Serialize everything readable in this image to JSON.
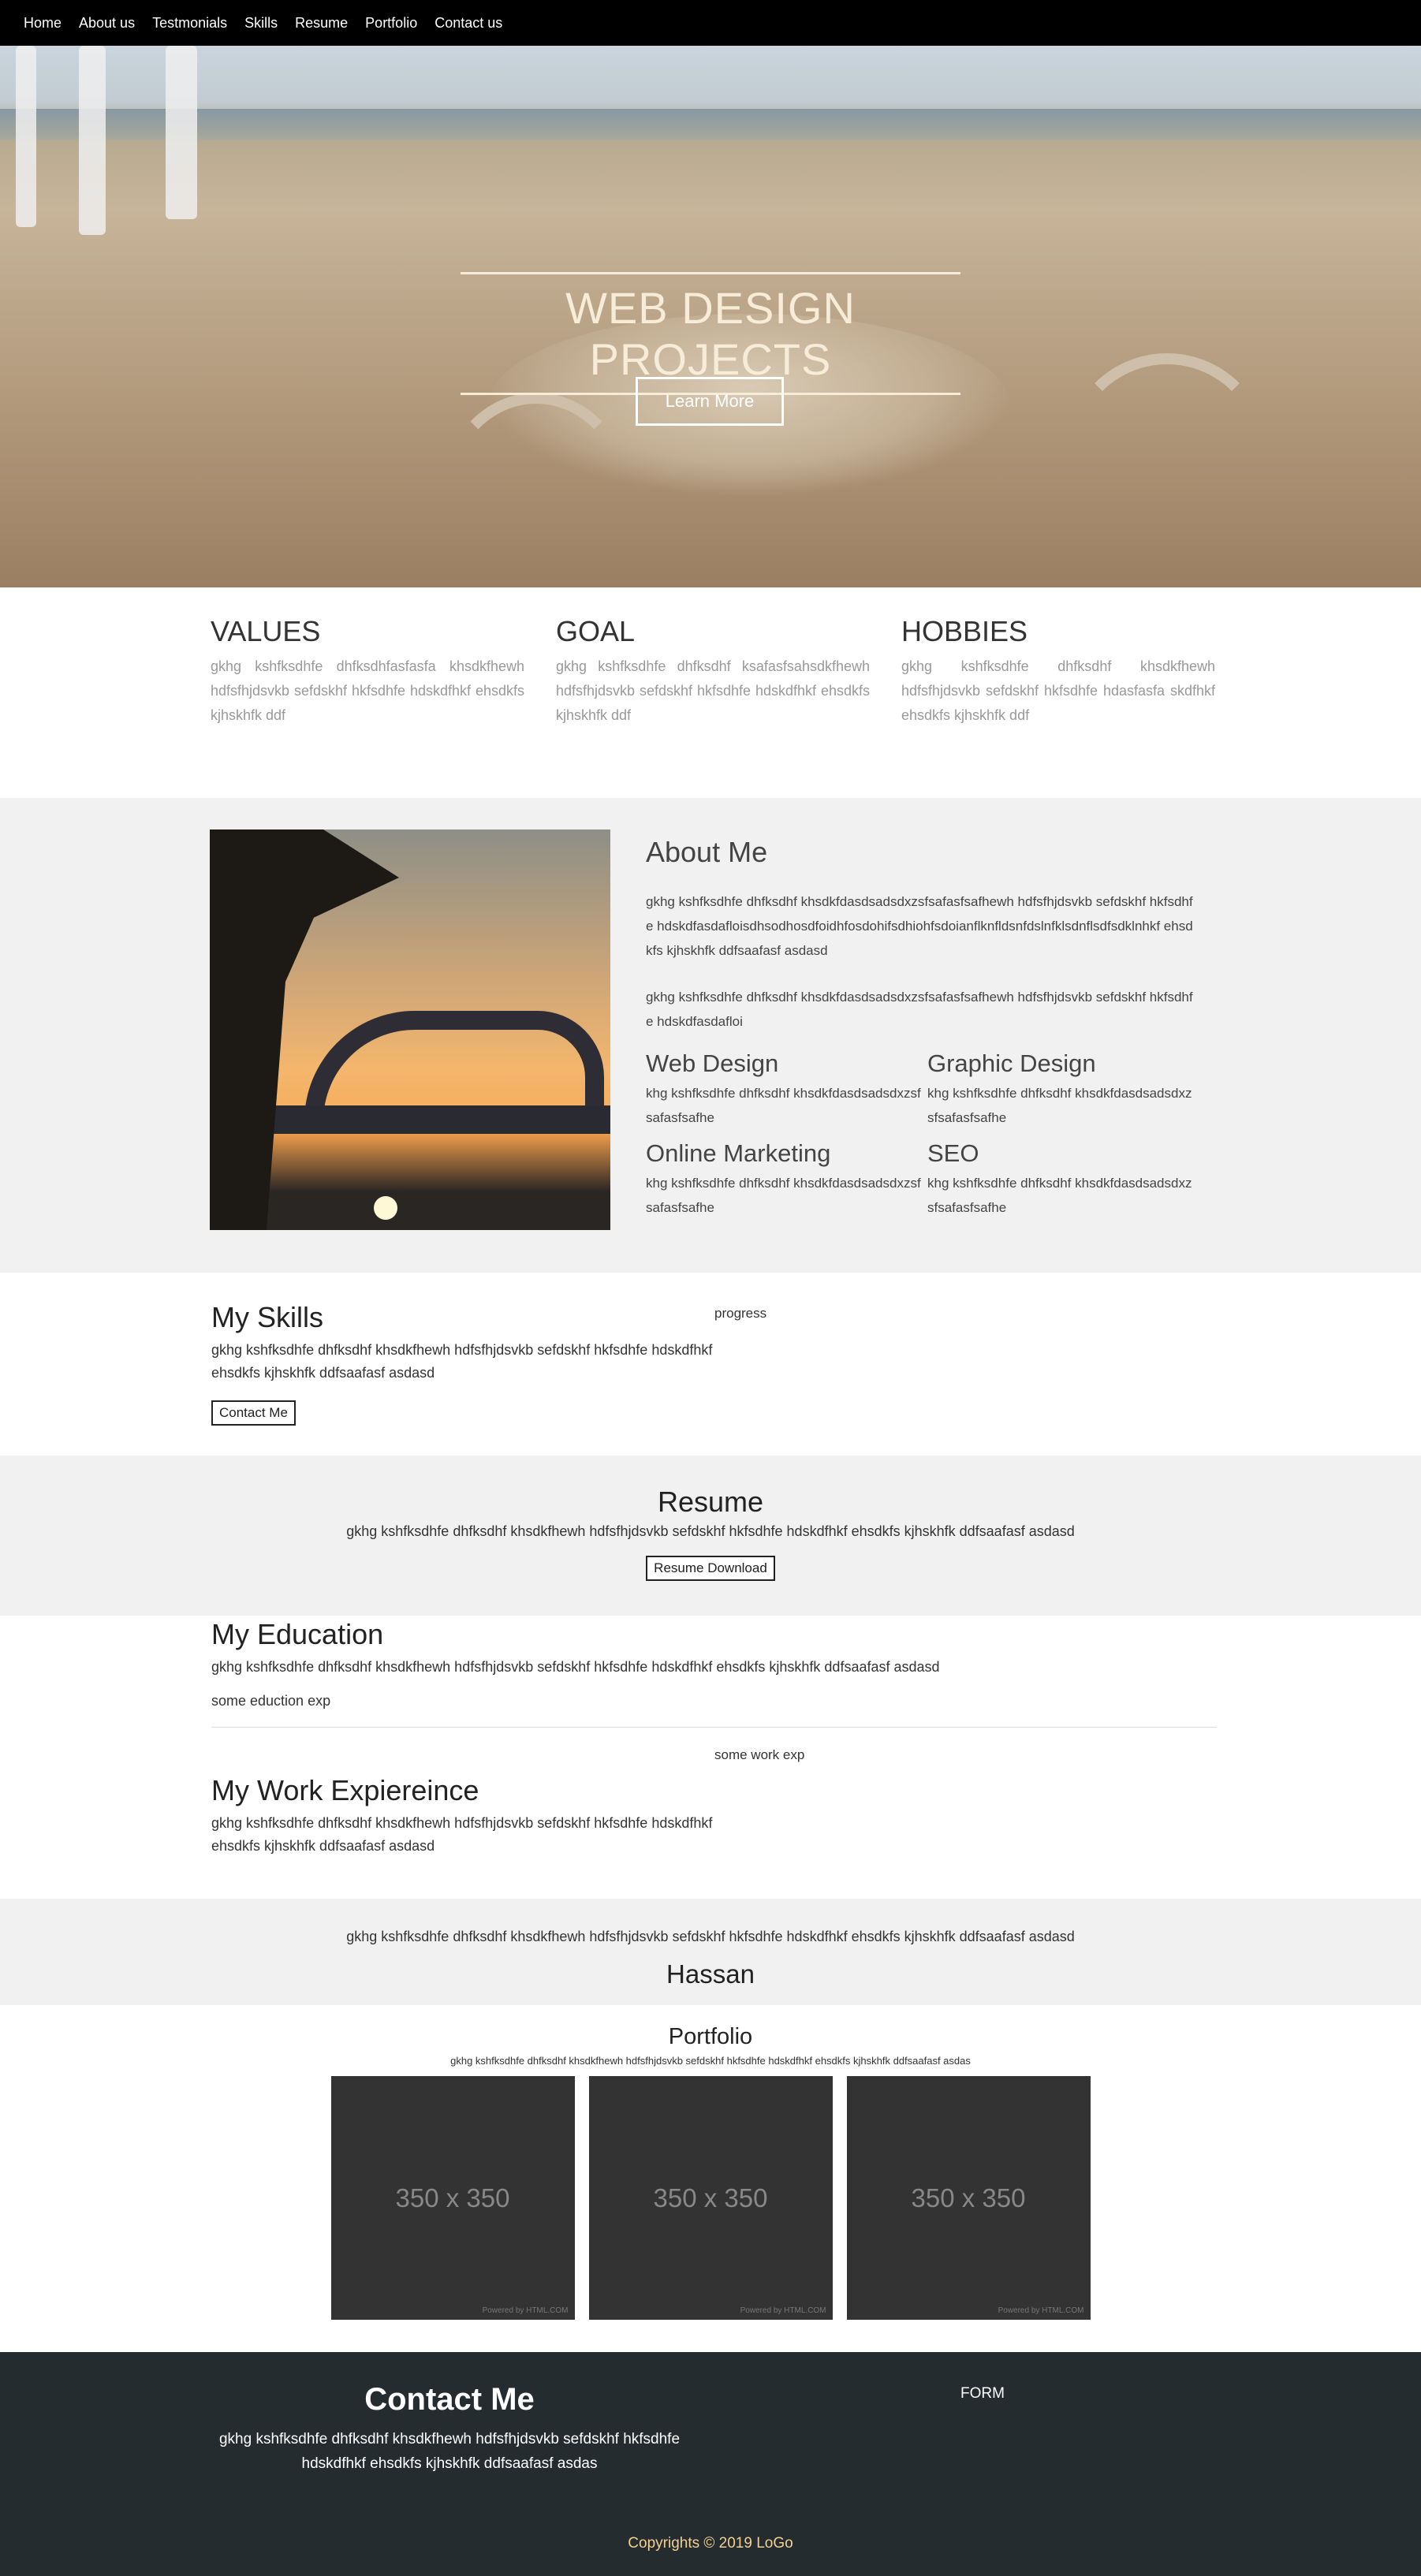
{
  "nav": {
    "items": [
      "Home",
      "About us",
      "Testmonials",
      "Skills",
      "Resume",
      "Portfolio",
      "Contact us"
    ]
  },
  "hero": {
    "title": "WEB DESIGN PROJECTS",
    "button": "Learn More"
  },
  "triple": [
    {
      "title": "VALUES",
      "text": "gkhg kshfksdhfe dhfksdhfasfasfa khsdkfhewh hdfsfhjdsvkb sefdskhf hkfsdhfe hdskdfhkf ehsdkfs kjhskhfk ddf"
    },
    {
      "title": "GOAL",
      "text": "gkhg kshfksdhfe dhfksdhf ksafasfsahsdkfhewh hdfsfhjdsvkb sefdskhf hkfsdhfe hdskdfhkf ehsdkfs kjhskhfk ddf"
    },
    {
      "title": "HOBBIES",
      "text": "gkhg kshfksdhfe dhfksdhf khsdkfhewh hdfsfhjdsvkb sefdskhf hkfsdhfe hdasfasfa skdfhkf ehsdkfs kjhskhfk ddf"
    }
  ],
  "about": {
    "title": "About Me",
    "p1": "gkhg kshfksdhfe dhfksdhf khsdkfdasdsadsdxzsfsafasfsafhewh hdfsfhjdsvkb sefdskhf hkfsdhfe hdskdfasdafloisdhsodhosdfoidhfosdohifsdhiohfsdoianflknfldsnfdslnfklsdnflsdfsdklnhkf ehsdkfs kjhskhfk ddfsaafasf asdasd",
    "p2": "gkhg kshfksdhfe dhfksdhf khsdkfdasdsadsdxzsfsafasfsafhewh hdfsfhjdsvkb sefdskhf hkfsdhfe hdskdfasdafloi",
    "services": [
      {
        "title": "Web Design",
        "text": "khg kshfksdhfe dhfksdhf khsdkfdasdsadsdxzsfsafasfsafhe"
      },
      {
        "title": "Graphic Design",
        "text": "khg kshfksdhfe dhfksdhf khsdkfdasdsadsdxzsfsafasfsafhe"
      },
      {
        "title": "Online Marketing",
        "text": "khg kshfksdhfe dhfksdhf khsdkfdasdsadsdxzsfsafasfsafhe"
      },
      {
        "title": "SEO",
        "text": "khg kshfksdhfe dhfksdhf khsdkfdasdsadsdxzsfsafasfsafhe"
      }
    ]
  },
  "skills": {
    "title": "My Skills",
    "text": "gkhg kshfksdhfe dhfksdhf khsdkfhewh hdfsfhjdsvkb sefdskhf hkfsdhfe hdskdfhkf ehsdkfs kjhskhfk ddfsaafasf asdasd",
    "button": "Contact Me",
    "progress_label": "progress"
  },
  "resume": {
    "title": "Resume",
    "text": "gkhg kshfksdhfe dhfksdhf khsdkfhewh hdfsfhjdsvkb sefdskhf hkfsdhfe hdskdfhkf ehsdkfs kjhskhfk ddfsaafasf asdasd",
    "button": "Resume Download"
  },
  "education": {
    "title": "My Education",
    "text": "gkhg kshfksdhfe dhfksdhf khsdkfhewh hdfsfhjdsvkb sefdskhf hkfsdhfe hdskdfhkf ehsdkfs kjhskhfk ddfsaafasf asdasd",
    "exp": "some eduction exp"
  },
  "work": {
    "label": "some work exp",
    "title": "My Work Expiereince",
    "text": "gkhg kshfksdhfe dhfksdhf khsdkfhewh hdfsfhjdsvkb sefdskhf hkfsdhfe hdskdfhkf ehsdkfs kjhskhfk ddfsaafasf asdasd"
  },
  "testimonial": {
    "text": "gkhg kshfksdhfe dhfksdhf khsdkfhewh hdfsfhjdsvkb sefdskhf hkfsdhfe hdskdfhkf ehsdkfs kjhskhfk ddfsaafasf asdasd",
    "name": "Hassan"
  },
  "portfolio": {
    "title": "Portfolio",
    "subtitle": "gkhg kshfksdhfe dhfksdhf khsdkfhewh hdfsfhjdsvkb sefdskhf hkfsdhfe hdskdfhkf ehsdkfs kjhskhfk ddfsaafasf asdas",
    "thumbs": [
      {
        "label": "350 x 350",
        "powered": "Powered by HTML.COM"
      },
      {
        "label": "350 x 350",
        "powered": "Powered by HTML.COM"
      },
      {
        "label": "350 x 350",
        "powered": "Powered by HTML.COM"
      }
    ]
  },
  "footer": {
    "title": "Contact Me",
    "text": "gkhg kshfksdhfe dhfksdhf khsdkfhewh hdfsfhjdsvkb sefdskhf hkfsdhfe hdskdfhkf ehsdkfs kjhskhfk ddfsaafasf asdas",
    "form": "FORM",
    "copyright": "Copyrights © 2019 LoGo"
  },
  "colors": {
    "nav_bg": "#000000",
    "section_alt_bg": "#f1f1f1",
    "footer_bg": "#252c30",
    "copyright": "#f3d08f",
    "hero_text": "#f6ecd8"
  }
}
